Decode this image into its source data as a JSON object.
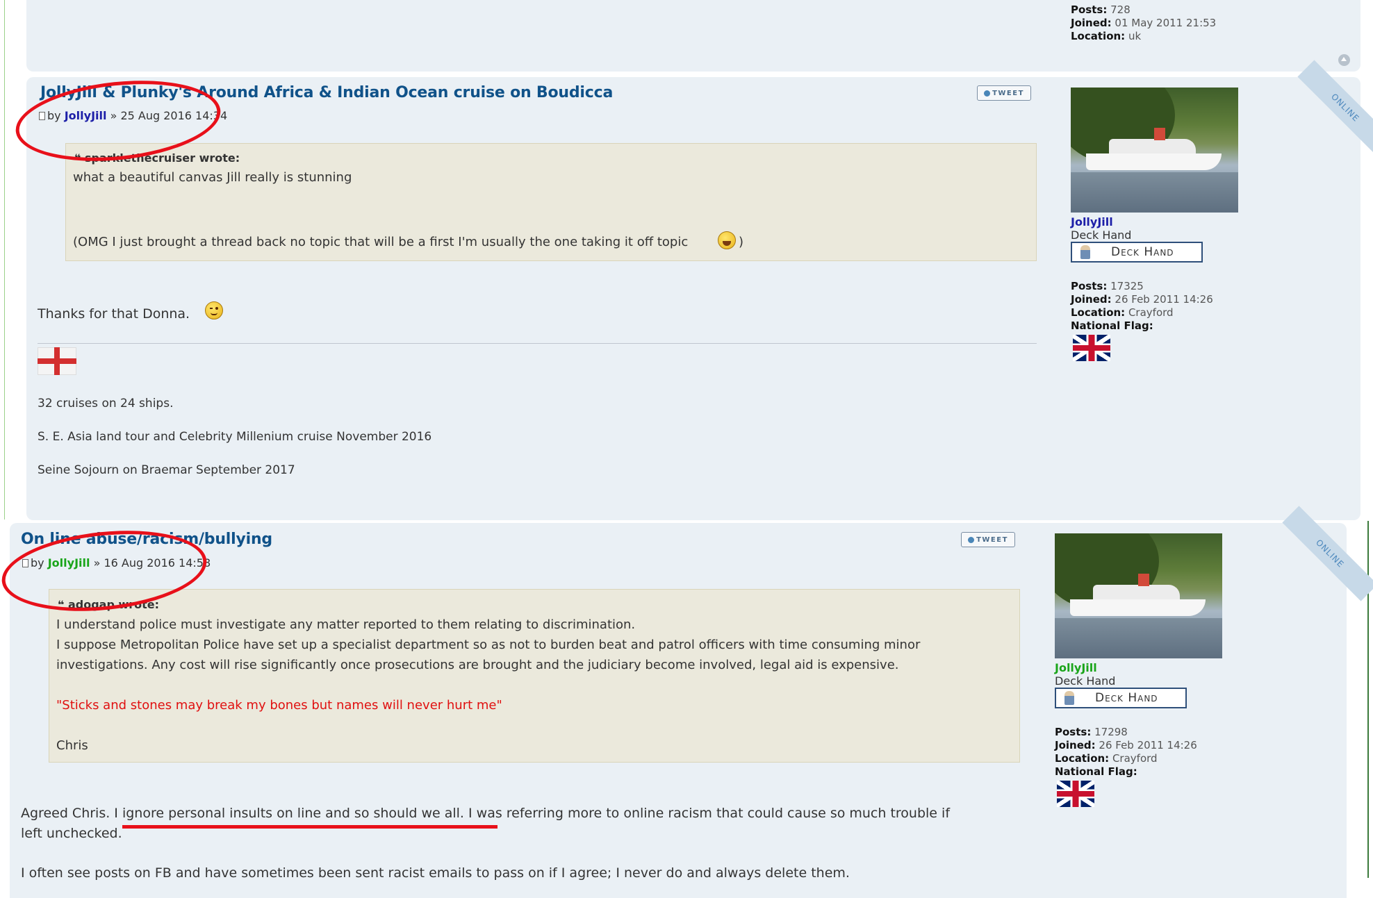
{
  "top_post_profile": {
    "posts_label": "Posts:",
    "posts_value": "728",
    "joined_label": "Joined:",
    "joined_value": "01 May 2011 21:53",
    "location_label": "Location:",
    "location_value": "uk"
  },
  "post1": {
    "title": "JollyJill & Plunky's Around Africa & Indian Ocean cruise on Boudicca",
    "by_label": "by",
    "author": "JollyJill",
    "date": "» 25 Aug 2016 14:34",
    "tweet_label": "TWEET",
    "online_label": "ONLINE",
    "quote_cite": "sparklethecruiser wrote:",
    "quote_lines": [
      "what a beautiful canvas Jill really is stunning",
      "(OMG I just brought a thread back no topic that will be a first I'm usually the one taking it off topic",
      ")"
    ],
    "body": "Thanks for that Donna.",
    "signature": [
      "32 cruises on 24 ships.",
      "S. E. Asia land tour and Celebrity Millenium cruise November 2016",
      "Seine Sojourn on Braemar September 2017"
    ],
    "profile": {
      "name": "JollyJill",
      "rank": "Deck Hand",
      "badge": "Deck Hand",
      "posts_label": "Posts:",
      "posts_value": "17325",
      "joined_label": "Joined:",
      "joined_value": "26 Feb 2011 14:26",
      "location_label": "Location:",
      "location_value": "Crayford",
      "flag_label": "National Flag:"
    }
  },
  "post2": {
    "title": "On line abuse/racism/bullying",
    "by_label": "by",
    "author": "JollyJill",
    "date": "» 16 Aug 2016 14:58",
    "tweet_label": "TWEET",
    "online_label": "ONLINE",
    "quote_cite": "adogap wrote:",
    "quote_lines": [
      "I understand police must investigate any matter reported to them relating to discrimination.",
      "I suppose Metropolitan Police have set up a specialist department so as not to burden beat and patrol officers with time consuming minor",
      "investigations. Any cost will rise significantly once prosecutions are brought and the judiciary become involved, legal aid is expensive.",
      "\"Sticks and stones may break my bones but names will never hurt me\"",
      "Chris"
    ],
    "body_lines": [
      "Agreed Chris. I ignore personal insults on line and so should we all. I was referring more to online racism that could cause so much trouble if",
      "left unchecked.",
      "I often see posts on FB and have sometimes been sent racist emails to pass on if I agree; I never do and always delete them."
    ],
    "profile": {
      "name": "JollyJill",
      "rank": "Deck Hand",
      "badge": "Deck Hand",
      "posts_label": "Posts:",
      "posts_value": "17298",
      "joined_label": "Joined:",
      "joined_value": "26 Feb 2011 14:26",
      "location_label": "Location:",
      "location_value": "Crayford",
      "flag_label": "National Flag:"
    }
  },
  "colors": {
    "title": "#105289",
    "author_post1": "#1d1fa8",
    "author_post2": "#1aa51a",
    "quote_red": "#e01010",
    "annotation": "#e8101a"
  },
  "icons": {
    "top": "arrow-up-circle-icon",
    "post": "document-icon",
    "quote": "quote-marks-icon",
    "smiley_laugh": "laughing-smiley-icon",
    "smiley_wink": "wink-smiley-icon"
  }
}
